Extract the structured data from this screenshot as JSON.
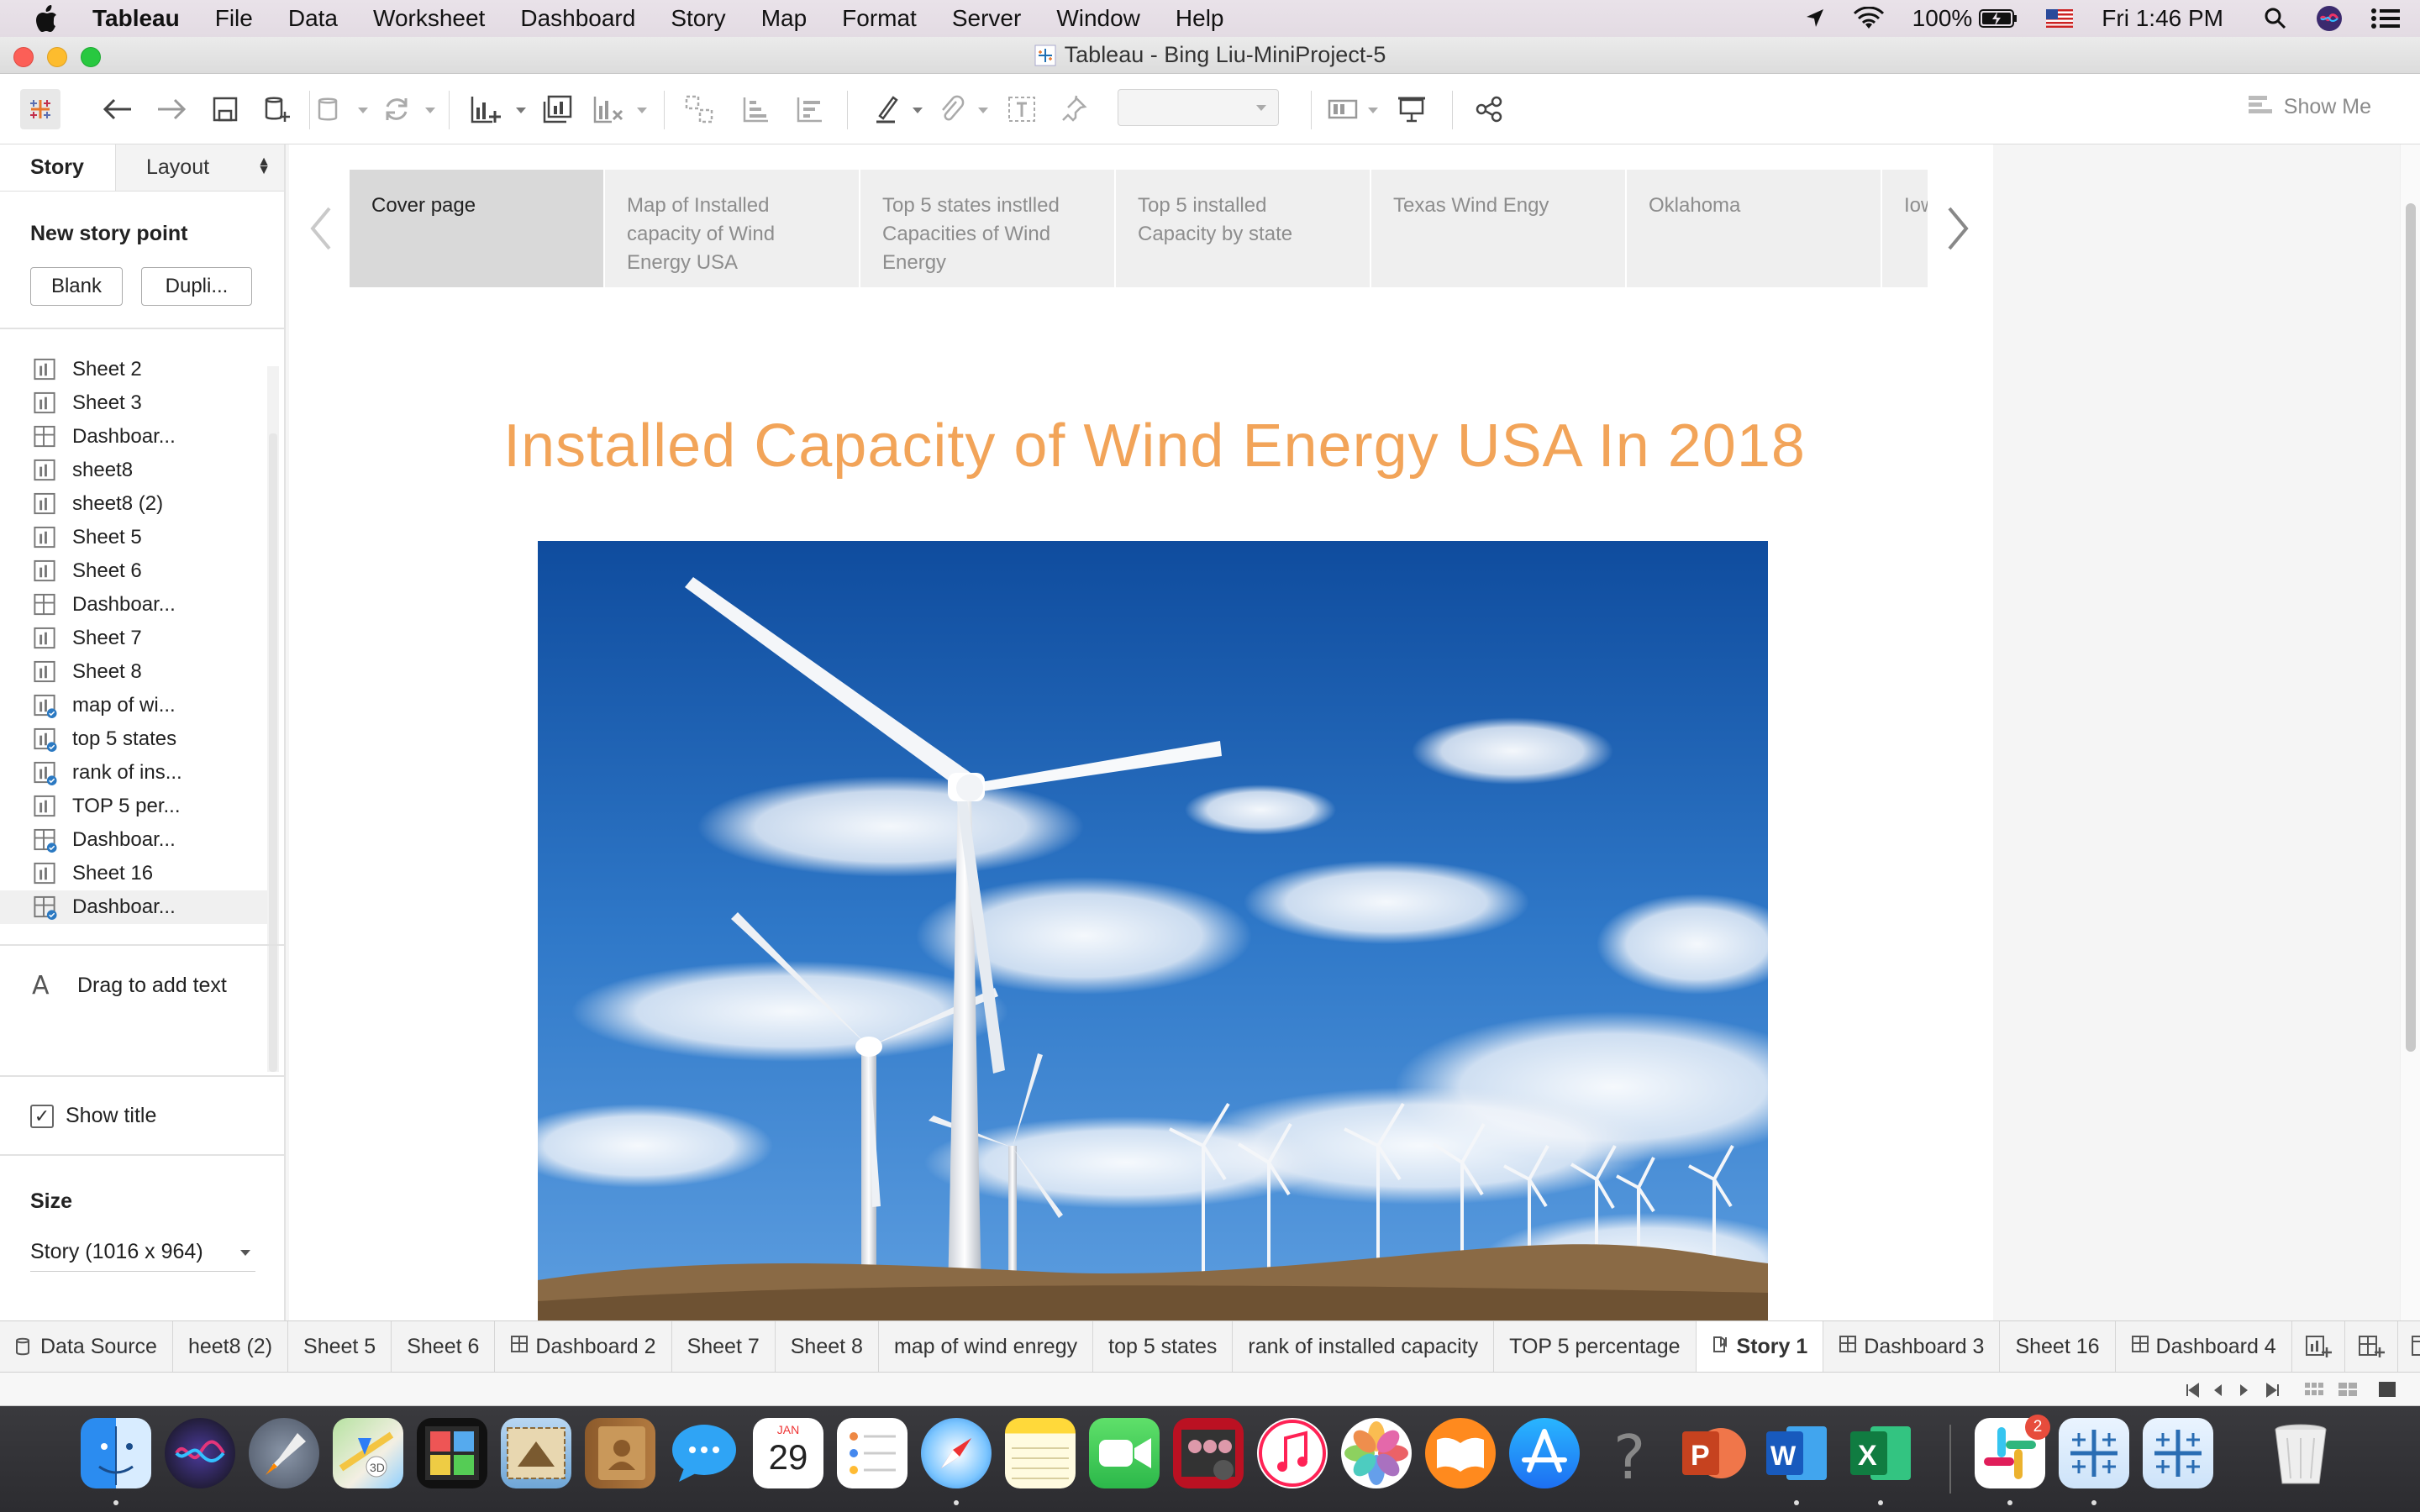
{
  "menubar": {
    "app_name": "Tableau",
    "items": [
      "File",
      "Data",
      "Worksheet",
      "Dashboard",
      "Story",
      "Map",
      "Format",
      "Server",
      "Window",
      "Help"
    ],
    "battery": "100%",
    "clock": "Fri 1:46 PM"
  },
  "window": {
    "title": "Tableau - Bing Liu-MiniProject-5"
  },
  "toolbar": {
    "show_me_label": "Show Me"
  },
  "left_pane": {
    "tab_story": "Story",
    "tab_layout": "Layout",
    "new_story_point": "New story point",
    "blank_button": "Blank",
    "duplicate_button": "Dupli...",
    "sheets": [
      {
        "label": "Sheet 2",
        "type": "sheet",
        "linked": false
      },
      {
        "label": "Sheet 3",
        "type": "sheet",
        "linked": false
      },
      {
        "label": "Dashboar...",
        "type": "dashboard",
        "linked": false
      },
      {
        "label": "sheet8",
        "type": "sheet",
        "linked": false
      },
      {
        "label": "sheet8 (2)",
        "type": "sheet",
        "linked": false
      },
      {
        "label": "Sheet 5",
        "type": "sheet",
        "linked": false
      },
      {
        "label": "Sheet 6",
        "type": "sheet",
        "linked": false
      },
      {
        "label": "Dashboar...",
        "type": "dashboard",
        "linked": false
      },
      {
        "label": "Sheet 7",
        "type": "sheet",
        "linked": false
      },
      {
        "label": "Sheet 8",
        "type": "sheet",
        "linked": false
      },
      {
        "label": "map of wi...",
        "type": "sheet",
        "linked": true
      },
      {
        "label": "top 5 states",
        "type": "sheet",
        "linked": true
      },
      {
        "label": "rank of ins...",
        "type": "sheet",
        "linked": true
      },
      {
        "label": "TOP 5 per...",
        "type": "sheet",
        "linked": false
      },
      {
        "label": "Dashboar...",
        "type": "dashboard",
        "linked": true
      },
      {
        "label": "Sheet 16",
        "type": "sheet",
        "linked": false
      },
      {
        "label": "Dashboar...",
        "type": "dashboard",
        "linked": true
      }
    ],
    "drag_text": "Drag to add text",
    "show_title": "Show title",
    "show_title_checked": true,
    "size_label": "Size",
    "size_value": "Story (1016 x 964)"
  },
  "story": {
    "points": [
      {
        "label": "Cover page",
        "active": true
      },
      {
        "label": "Map of Installed capacity of Wind Energy USA",
        "active": false
      },
      {
        "label": "Top 5 states instlled Capacities of Wind Energy",
        "active": false
      },
      {
        "label": "Top 5  installed Capacity by state",
        "active": false
      },
      {
        "label": "Texas Wind Engy",
        "active": false
      },
      {
        "label": "Oklahoma",
        "active": false
      },
      {
        "label": "Iowa",
        "active": false
      }
    ],
    "title": "Installed Capacity of Wind Energy USA In 2018"
  },
  "sheet_tabs": {
    "data_source": "Data Source",
    "tabs": [
      {
        "label": "heet8 (2)",
        "type": "sheet",
        "active": false
      },
      {
        "label": "Sheet 5",
        "type": "sheet",
        "active": false
      },
      {
        "label": "Sheet 6",
        "type": "sheet",
        "active": false
      },
      {
        "label": "Dashboard 2",
        "type": "dashboard",
        "active": false
      },
      {
        "label": "Sheet 7",
        "type": "sheet",
        "active": false
      },
      {
        "label": "Sheet 8",
        "type": "sheet",
        "active": false
      },
      {
        "label": "map of wind enregy",
        "type": "sheet",
        "active": false
      },
      {
        "label": "top 5 states",
        "type": "sheet",
        "active": false
      },
      {
        "label": "rank of installed capacity",
        "type": "sheet",
        "active": false
      },
      {
        "label": "TOP 5 percentage",
        "type": "sheet",
        "active": false
      },
      {
        "label": "Story 1",
        "type": "story",
        "active": true
      },
      {
        "label": "Dashboard 3",
        "type": "dashboard",
        "active": false
      },
      {
        "label": "Sheet 16",
        "type": "sheet",
        "active": false
      },
      {
        "label": "Dashboard 4",
        "type": "dashboard",
        "active": false
      }
    ]
  },
  "dock": {
    "calendar_month": "JAN",
    "calendar_day": "29",
    "slack_badge": "2",
    "apps": [
      "finder-icon",
      "siri-icon",
      "launchpad-icon",
      "maps-icon",
      "photo-booth-icon",
      "mail-icon",
      "contacts-icon",
      "messages-icon",
      "calendar-icon",
      "reminders-icon",
      "safari-icon",
      "notes-icon",
      "facetime-icon",
      "photo-app-icon",
      "music-icon",
      "photos-icon",
      "books-icon",
      "app-store-icon",
      "help-icon",
      "powerpoint-icon",
      "word-icon",
      "excel-icon",
      "slack-icon",
      "tableau-icon",
      "tableau-icon",
      "trash-icon"
    ]
  }
}
